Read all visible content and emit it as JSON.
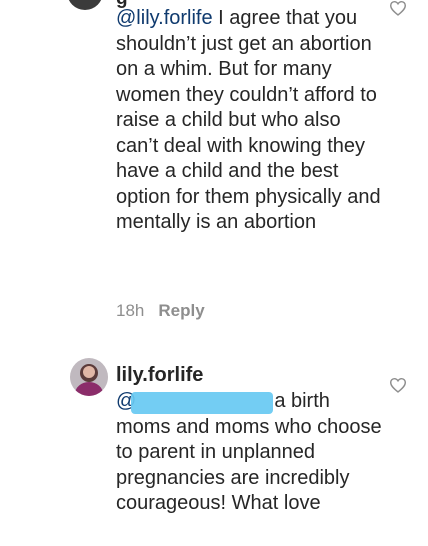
{
  "comments": [
    {
      "username_partial": "g",
      "mention": "@lily.forlife",
      "text": " I agree that you shouldn’t just get an abortion on a whim. But for many women they couldn’t afford to raise a child but who also can’t deal with knowing they have a child and the best option for them physically and mentally is an abortion",
      "time": "18h",
      "reply_label": "Reply",
      "like_icon": "heart-outline-icon"
    },
    {
      "username": "lily.forlife",
      "mention": "@",
      "text_after_redaction": "a birth",
      "text": "moms and moms who choose to parent in unplanned pregnancies are incredibly courageous! What love",
      "like_icon": "heart-outline-icon",
      "redaction_color": "#67c9f2"
    }
  ]
}
